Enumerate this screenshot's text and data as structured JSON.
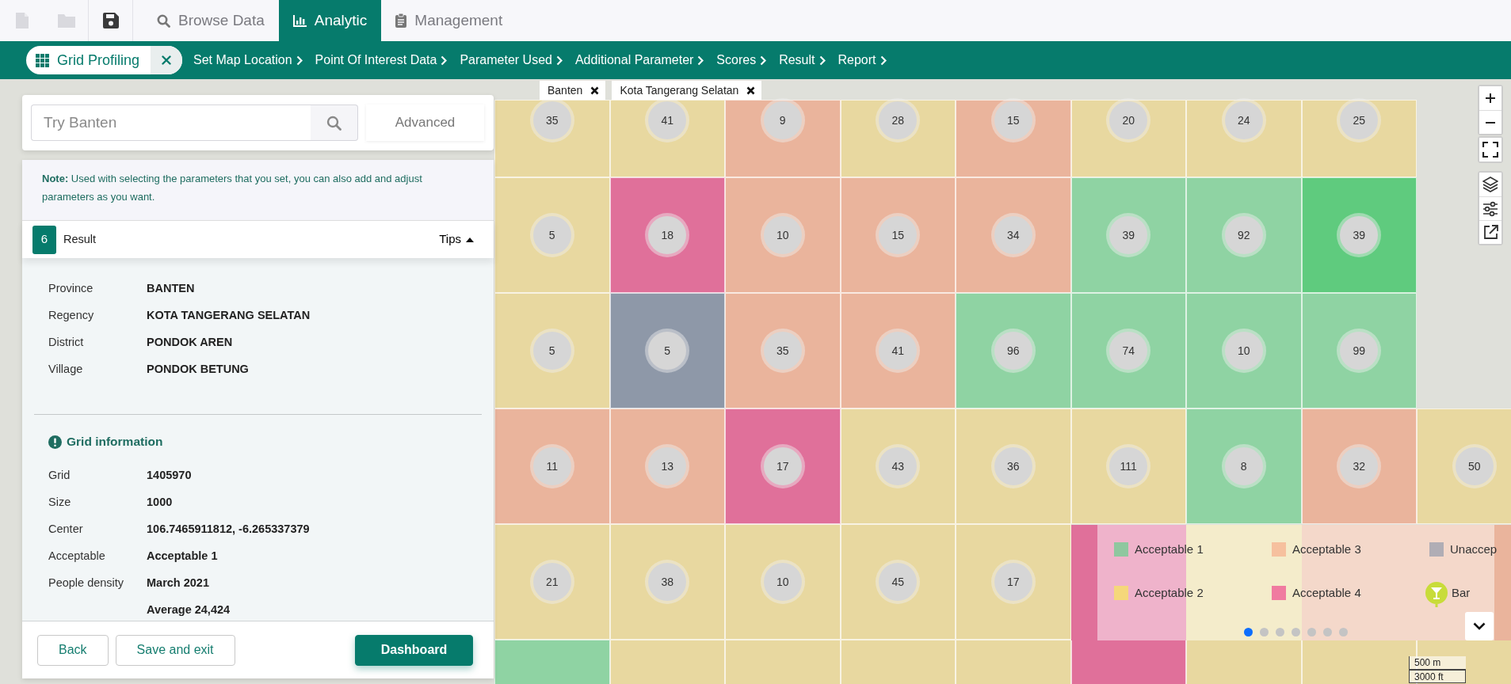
{
  "toolbar": [
    {
      "kind": "file",
      "disabled": true
    },
    {
      "kind": "folder",
      "disabled": true
    },
    {
      "kind": "save",
      "disabled": false
    }
  ],
  "tabs": [
    {
      "label": "Browse Data",
      "kind": "search",
      "selected": false
    },
    {
      "label": "Analytic",
      "kind": "chart",
      "selected": true
    },
    {
      "label": "Management",
      "kind": "clipboard",
      "selected": false
    }
  ],
  "workflow": {
    "title": "Grid Profiling",
    "steps": [
      "Set Map Location",
      "Point Of Interest Data",
      "Parameter Used",
      "Additional Parameter",
      "Scores",
      "Result",
      "Report"
    ]
  },
  "search": {
    "placeholder": "Try Banten",
    "advanced": "Advanced"
  },
  "note": "**Note:** Used with selecting the parameters that you set, you can also add and adjust parameters as you want.",
  "step": {
    "number": "6",
    "title": "Result",
    "tips": "Tips"
  },
  "area_info": [
    {
      "label": "Province",
      "value": "BANTEN"
    },
    {
      "label": "Regency",
      "value": "KOTA TANGERANG SELATAN"
    },
    {
      "label": "District",
      "value": "PONDOK AREN"
    },
    {
      "label": "Village",
      "value": "PONDOK BETUNG"
    }
  ],
  "grid_info": {
    "title": "Grid information",
    "rows": [
      {
        "label": "Grid",
        "value": "1405970"
      },
      {
        "label": "Size",
        "value": "1000"
      },
      {
        "label": "Center",
        "value": "106.7465911812, -6.265337379"
      },
      {
        "label": "Acceptable",
        "value": "Acceptable 1"
      },
      {
        "label": "People density",
        "value": "March 2021"
      },
      {
        "value": "Average 24,424"
      }
    ]
  },
  "buttons": [
    {
      "label": "Back",
      "kind": "outline"
    },
    {
      "label": "Save and exit",
      "kind": "outline"
    },
    {
      "label": "Dashboard",
      "kind": "primary"
    }
  ],
  "filters": [
    "Banten",
    "Kota Tangerang Selatan"
  ],
  "grid": [
    [
      {
        "color": "#e8d8a0",
        "count": "35"
      },
      {
        "color": "#e8d8a0",
        "count": "41"
      },
      {
        "color": "#eab49c",
        "count": "9"
      },
      {
        "color": "#e8d8a0",
        "count": "28"
      },
      {
        "color": "#eab49c",
        "count": "15"
      },
      {
        "color": "#e8d8a0",
        "count": "20"
      },
      {
        "color": "#e8d8a0",
        "count": "24"
      },
      {
        "color": "#e8d8a0",
        "count": "25"
      }
    ],
    [
      {
        "color": "#e8d8a0",
        "count": "5"
      },
      {
        "color": "#e0709a",
        "count": "18"
      },
      {
        "color": "#eab49c",
        "count": "10"
      },
      {
        "color": "#eab49c",
        "count": "15"
      },
      {
        "color": "#eab49c",
        "count": "34"
      },
      {
        "color": "#8fd3a3",
        "count": "39"
      },
      {
        "color": "#8fd3a3",
        "count": "92"
      },
      {
        "color": "#5fcb7e",
        "count": "39"
      }
    ],
    [
      {
        "color": "#e8d8a0",
        "count": "5"
      },
      {
        "color": "#8e98a8",
        "count": "5"
      },
      {
        "color": "#eab49c",
        "count": "35"
      },
      {
        "color": "#eab49c",
        "count": "41"
      },
      {
        "color": "#8fd3a3",
        "count": "96"
      },
      {
        "color": "#8fd3a3",
        "count": "74"
      },
      {
        "color": "#8fd3a3",
        "count": "10"
      },
      {
        "color": "#8fd3a3",
        "count": "99"
      }
    ],
    [
      {
        "color": "#eab49c",
        "count": "11"
      },
      {
        "color": "#eab49c",
        "count": "13"
      },
      {
        "color": "#e0709a",
        "count": "17"
      },
      {
        "color": "#e8d8a0",
        "count": "43"
      },
      {
        "color": "#e8d8a0",
        "count": "36"
      },
      {
        "color": "#e8d8a0",
        "count": "111"
      },
      {
        "color": "#8fd3a3",
        "count": "8"
      },
      {
        "color": "#eab49c",
        "count": "32"
      },
      {
        "color": "#e8d8a0",
        "count": "50"
      }
    ],
    [
      {
        "color": "#e8d8a0",
        "count": "21"
      },
      {
        "color": "#e8d8a0",
        "count": "38"
      },
      {
        "color": "#e8d8a0",
        "count": "10"
      },
      {
        "color": "#e8d8a0",
        "count": "45"
      },
      {
        "color": "#e8d8a0",
        "count": "17"
      }
    ],
    [
      {
        "color": "#8fd3a3"
      },
      {
        "color": "#e8d8a0"
      },
      {
        "color": "#e8d8a0"
      },
      {
        "color": "#e8d8a0"
      },
      {
        "color": "#e8d8a0"
      },
      {
        "color": "#e0709a"
      },
      {
        "color": "#e8d8a0"
      },
      {
        "color": "#e8d8a0"
      },
      {
        "color": "#e8d8a0"
      }
    ]
  ],
  "legend": {
    "items": [
      {
        "label": "Acceptable 1",
        "kind": "swatch",
        "color": "#8fc79f"
      },
      {
        "label": "Acceptable 3",
        "kind": "swatch",
        "color": "#f6c09e"
      },
      {
        "label": "Unaccep",
        "kind": "swatch",
        "color": "#b0adb5"
      },
      {
        "label": "Acceptable 2",
        "kind": "swatch",
        "color": "#f5d77a"
      },
      {
        "label": "Acceptable 4",
        "kind": "swatch",
        "color": "#f07ba0"
      },
      {
        "label": "Bar",
        "kind": "poi",
        "color": "#c8dc3a"
      }
    ],
    "pages": [
      {
        "selected": true
      },
      {
        "selected": false
      },
      {
        "selected": false
      },
      {
        "selected": false
      },
      {
        "selected": false
      },
      {
        "selected": false
      },
      {
        "selected": false
      }
    ]
  },
  "scale": [
    "500 m",
    "3000 ft"
  ]
}
